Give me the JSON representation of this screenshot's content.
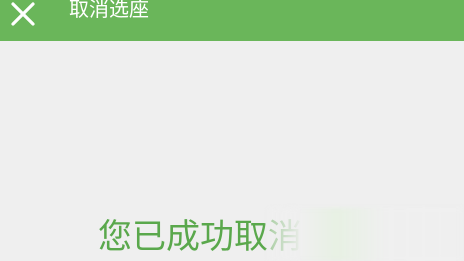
{
  "header": {
    "title": "取消选座",
    "close_icon": "close-icon",
    "bg_color": "#6ab65a"
  },
  "main": {
    "message": "您已成功取消",
    "message_color": "#5aa84c",
    "bg_color": "#efefef"
  }
}
